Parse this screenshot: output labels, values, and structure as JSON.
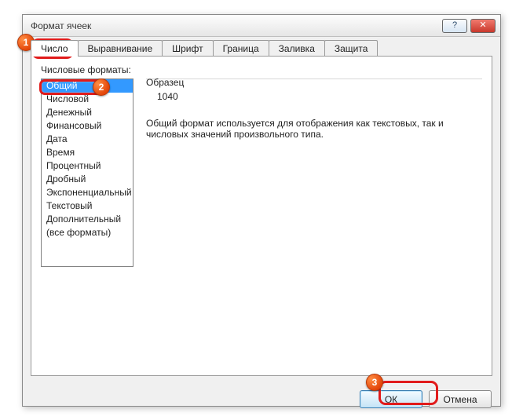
{
  "window": {
    "title": "Формат ячеек",
    "help_glyph": "?",
    "close_glyph": "✕"
  },
  "tabs": [
    "Число",
    "Выравнивание",
    "Шрифт",
    "Граница",
    "Заливка",
    "Защита"
  ],
  "panel": {
    "list_label": "Числовые форматы:",
    "categories": [
      "Общий",
      "Числовой",
      "Денежный",
      "Финансовый",
      "Дата",
      "Время",
      "Процентный",
      "Дробный",
      "Экспоненциальный",
      "Текстовый",
      "Дополнительный",
      "(все форматы)"
    ],
    "selected_index": 0,
    "sample_caption": "Образец",
    "sample_value": "1040",
    "description": "Общий формат используется для отображения как текстовых, так и числовых значений произвольного типа."
  },
  "buttons": {
    "ok": "ОК",
    "cancel": "Отмена"
  },
  "annotations": {
    "b1": "1",
    "b2": "2",
    "b3": "3"
  }
}
